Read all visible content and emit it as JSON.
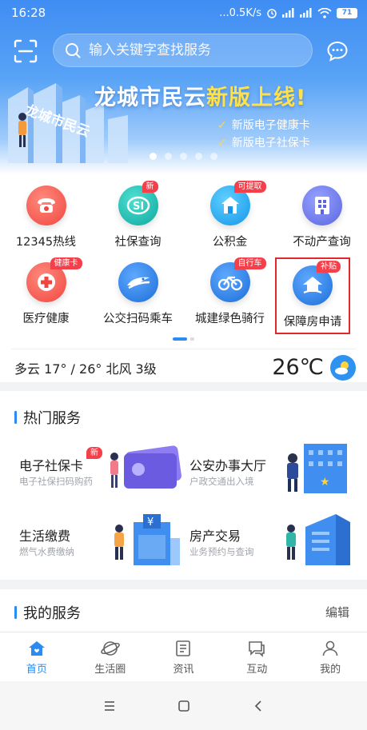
{
  "status_bar": {
    "time": "16:28",
    "network_speed": "...0.5K/s",
    "battery": "71"
  },
  "search": {
    "placeholder": "输入关键字查找服务"
  },
  "banner": {
    "title_part1": "龙城市民云",
    "title_highlight": "新版上线!",
    "items": [
      "新版电子健康卡",
      "新版电子社保卡"
    ],
    "art_text": "龙城市民云",
    "dot_count": 5,
    "active_dot": 0
  },
  "services": [
    {
      "label": "12345热线",
      "icon": "phone-icon",
      "color": "#f45b53",
      "badge": ""
    },
    {
      "label": "社保查询",
      "icon": "social-security-icon",
      "color": "#1bb9b0",
      "badge": "新"
    },
    {
      "label": "公积金",
      "icon": "house-fund-icon",
      "color": "#1fa6ee",
      "badge": "可提取"
    },
    {
      "label": "不动产查询",
      "icon": "real-estate-icon",
      "color": "#6b78e8",
      "badge": ""
    },
    {
      "label": "医疗健康",
      "icon": "medical-cross-icon",
      "color": "#f45b53",
      "badge": "健康卡"
    },
    {
      "label": "公交扫码乘车",
      "icon": "bus-icon",
      "color": "#2d82e6",
      "badge": ""
    },
    {
      "label": "城建绿色骑行",
      "icon": "bicycle-icon",
      "color": "#2d82e6",
      "badge": "自行车"
    },
    {
      "label": "保障房申请",
      "icon": "affordable-housing-icon",
      "color": "#2d82e6",
      "badge": "补贴"
    }
  ],
  "weather": {
    "description": "多云  17° / 26°  北风 3级",
    "temperature": "26℃",
    "icon": "partly-cloudy-icon"
  },
  "hot_services": {
    "title": "热门服务",
    "items": [
      {
        "title": "电子社保卡",
        "subtitle": "电子社保扫码购药",
        "badge": "新"
      },
      {
        "title": "公安办事大厅",
        "subtitle": "户政交通出入境",
        "badge": ""
      },
      {
        "title": "生活缴费",
        "subtitle": "燃气水费缴纳",
        "badge": ""
      },
      {
        "title": "房产交易",
        "subtitle": "业务预约与查询",
        "badge": ""
      }
    ]
  },
  "my_services": {
    "title": "我的服务",
    "edit_label": "编辑"
  },
  "tabs": [
    {
      "label": "首页",
      "icon": "home-icon",
      "active": true
    },
    {
      "label": "生活圈",
      "icon": "planet-icon",
      "active": false
    },
    {
      "label": "资讯",
      "icon": "news-icon",
      "active": false
    },
    {
      "label": "互动",
      "icon": "chat-icon",
      "active": false
    },
    {
      "label": "我的",
      "icon": "user-icon",
      "active": false
    }
  ],
  "colors": {
    "primary": "#2a8bf2",
    "badge": "#f4404a",
    "highlight_outline": "#e0292c"
  }
}
